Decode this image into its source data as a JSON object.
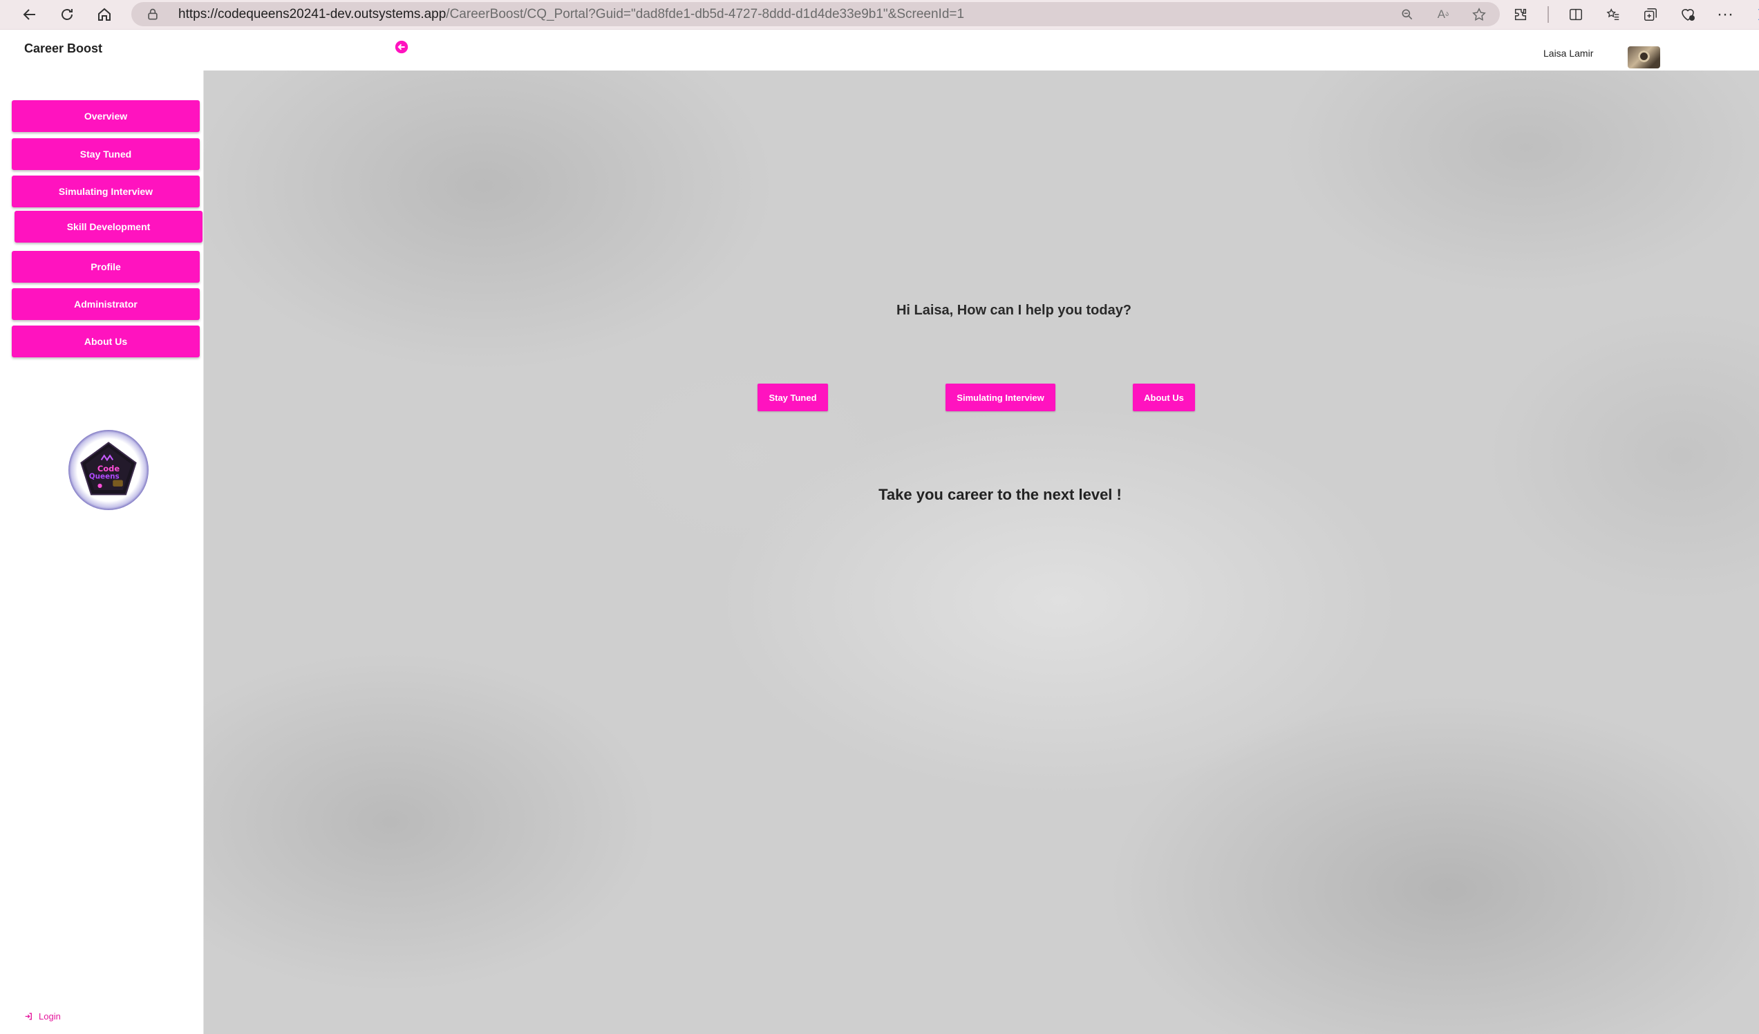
{
  "browser": {
    "url_host": "https://codequeens20241-dev.outsystems.app",
    "url_path": "/CareerBoost/CQ_Portal?Guid=\"dad8fde1-db5d-4727-8ddd-d1d4de33e9b1\"&ScreenId=1"
  },
  "header": {
    "app_title": "Career Boost",
    "user_name": "Laisa Lamir"
  },
  "sidebar": {
    "items": [
      {
        "label": "Overview"
      },
      {
        "label": "Stay Tuned"
      },
      {
        "label": "Simulating Interview"
      },
      {
        "label": "Skill Development"
      },
      {
        "label": "Profile"
      },
      {
        "label": "Administrator"
      },
      {
        "label": "About Us"
      }
    ],
    "login_label": "Login"
  },
  "main": {
    "greeting": "Hi Laisa, How can I help you today?",
    "quick_buttons": [
      {
        "label": "Stay Tuned"
      },
      {
        "label": "Simulating Interview"
      },
      {
        "label": "About Us"
      }
    ],
    "tagline": "Take you career to the next level !"
  },
  "colors": {
    "accent": "#ff13bf",
    "background": "#cfcfcf"
  }
}
